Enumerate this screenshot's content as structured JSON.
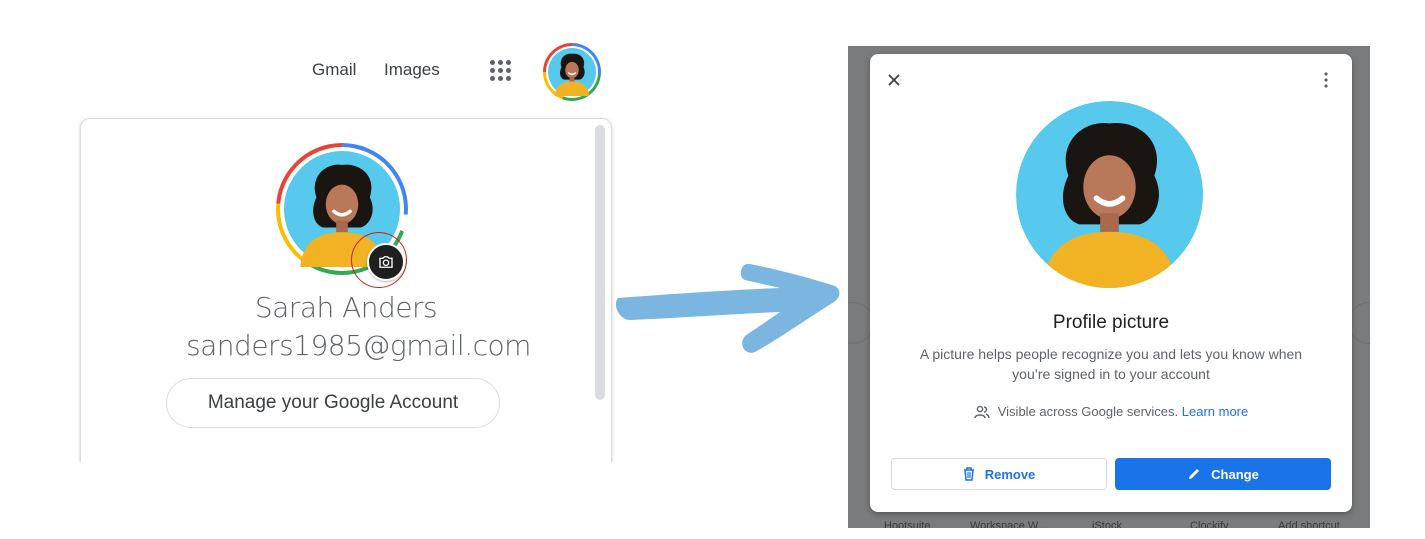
{
  "left": {
    "topbar": {
      "gmail_label": "Gmail",
      "images_label": "Images",
      "apps_icon": "apps-grid-icon",
      "avatar_icon": "account-avatar"
    },
    "account_card": {
      "name": "Sarah Anders",
      "email": "sanders1985@gmail.com",
      "manage_button_label": "Manage your Google Account",
      "camera_icon": "camera-icon",
      "ring_colors": [
        "#4285f4",
        "#34a853",
        "#fbbc05",
        "#ea4335"
      ],
      "highlight_color": "#c5221f"
    }
  },
  "annotation": {
    "arrow_color": "#7ab6e0",
    "arrow_icon": "right-arrow-icon"
  },
  "right": {
    "dialog": {
      "close_icon": "close-icon",
      "more_icon": "more-vertical-icon",
      "title": "Profile picture",
      "description": "A picture helps people recognize you and lets you know when you’re signed in to your account",
      "visibility_text": "Visible across Google services.",
      "learn_more_label": "Learn more",
      "remove_label": "Remove",
      "change_label": "Change",
      "accent_color": "#1a73e8"
    },
    "background_shortcuts": [
      "Hootsuite",
      "Workspace W...",
      "iStock",
      "Clockify",
      "Add shortcut"
    ]
  }
}
